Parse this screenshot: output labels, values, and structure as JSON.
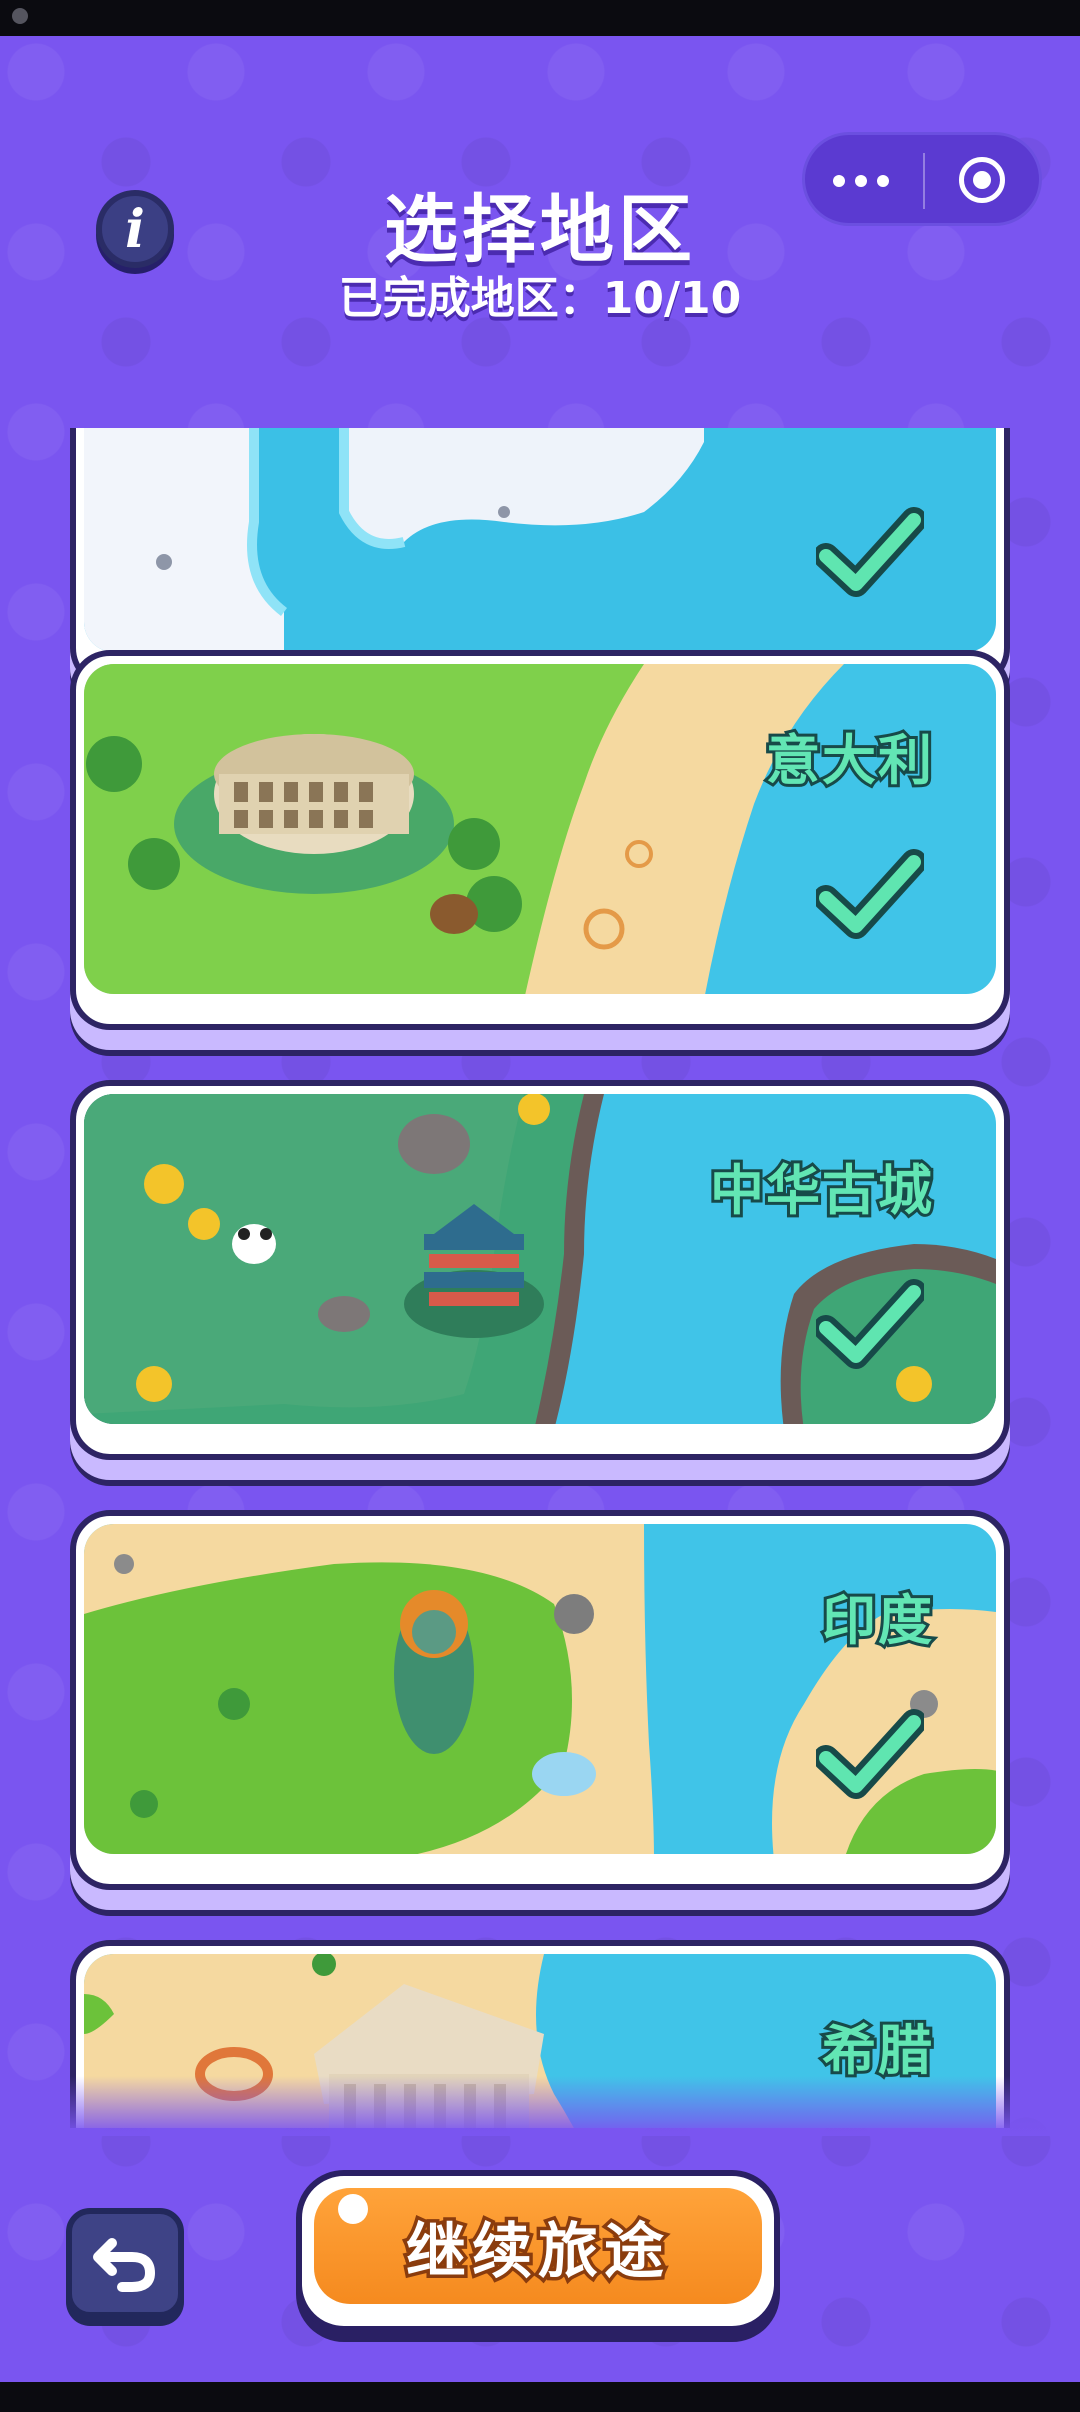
{
  "header": {
    "title": "选择地区",
    "progress_label": "已完成地区：10/10",
    "completed": 10,
    "total": 10
  },
  "regions": [
    {
      "name": "",
      "completed": true
    },
    {
      "name": "意大利",
      "completed": true
    },
    {
      "name": "中华古城",
      "completed": true
    },
    {
      "name": "印度",
      "completed": true
    },
    {
      "name": "希腊",
      "completed": true
    }
  ],
  "footer": {
    "continue_label": "继续旅途"
  },
  "icons": {
    "info": "info-icon",
    "back": "undo-arrow-icon",
    "more": "more-dots-icon",
    "close": "target-icon",
    "check": "check-icon"
  },
  "colors": {
    "background": "#7a55f0",
    "region_label": "#62e6b4",
    "check": "#5fe5b0",
    "continue_button": "#f58a1f"
  }
}
